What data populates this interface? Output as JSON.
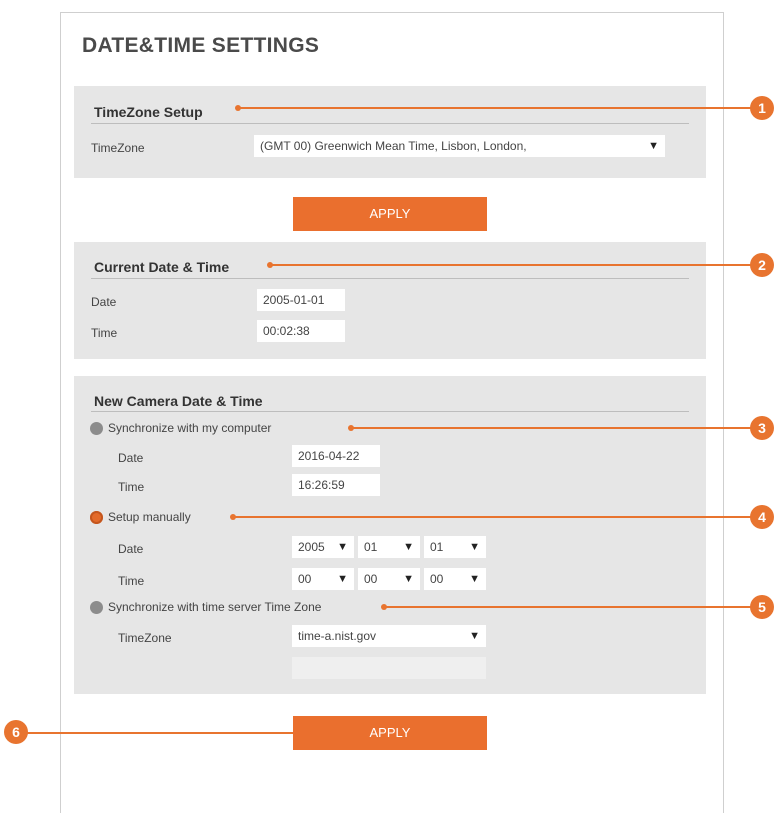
{
  "page_title": "DATE&TIME SETTINGS",
  "timezone_setup": {
    "title": "TimeZone Setup",
    "timezone_label": "TimeZone",
    "timezone_value": "(GMT  00) Greenwich Mean Time, Lisbon, London,",
    "apply_label": "APPLY"
  },
  "current": {
    "title": "Current Date & Time",
    "date_label": "Date",
    "date_value": "2005-01-01",
    "time_label": "Time",
    "time_value": "00:02:38"
  },
  "new_camera": {
    "title": "New Camera Date & Time",
    "sync_computer_label": "Synchronize with my computer",
    "sync_date_label": "Date",
    "sync_date_value": "2016-04-22",
    "sync_time_label": "Time",
    "sync_time_value": "16:26:59",
    "manual_label": "Setup manually",
    "manual_date_label": "Date",
    "manual_year": "2005",
    "manual_month": "01",
    "manual_day": "01",
    "manual_time_label": "Time",
    "manual_hour": "00",
    "manual_minute": "00",
    "manual_second": "00",
    "server_label": "Synchronize with time server Time Zone",
    "server_timezone_label": "TimeZone",
    "server_value": "time-a.nist.gov",
    "server_extra_value": "",
    "selected_mode": "manual",
    "apply_label": "APPLY"
  },
  "callouts": [
    "1",
    "2",
    "3",
    "4",
    "5",
    "6"
  ],
  "icons": {
    "dropdown": "triangle-down-icon",
    "radio": "radio-icon"
  },
  "colors": {
    "accent": "#e8742f",
    "panel": "#e6e6e6",
    "button": "#ea6f2e"
  }
}
